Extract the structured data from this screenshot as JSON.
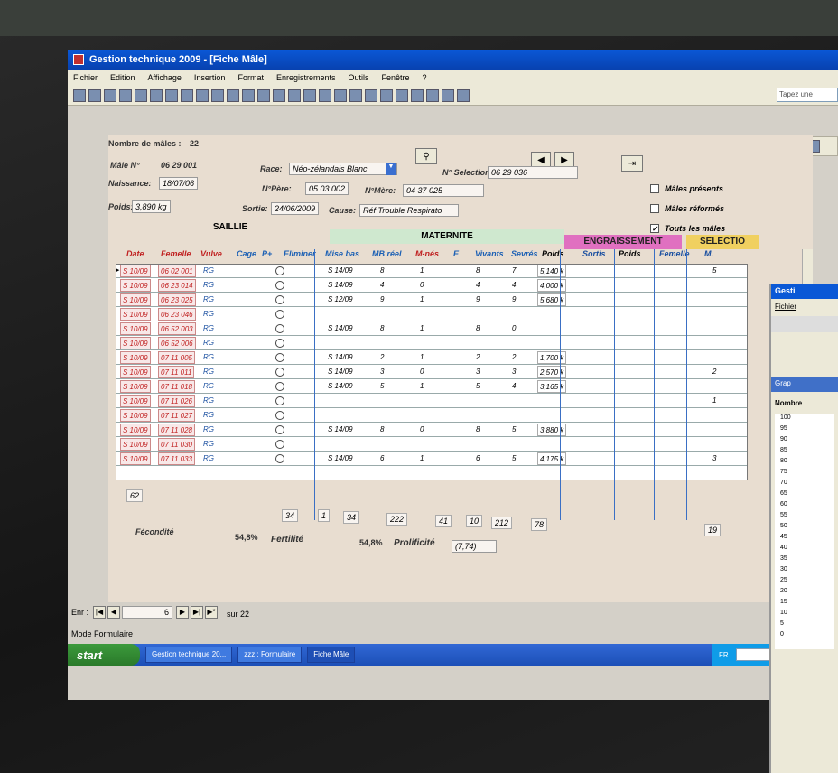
{
  "window": {
    "title": "Gestion technique 2009 - [Fiche Mâle]"
  },
  "menu": [
    "Fichier",
    "Edition",
    "Affichage",
    "Insertion",
    "Format",
    "Enregistrements",
    "Outils",
    "Fenêtre",
    "?"
  ],
  "ask_placeholder": "Tapez une",
  "header": {
    "count_label": "Nombre de mâles :",
    "count_value": "22",
    "male_label": "Mâle N°",
    "male_value": "06 29 001",
    "naissance_label": "Naissance:",
    "naissance_value": "18/07/06",
    "race_label": "Race:",
    "race_value": "Néo-zélandais Blanc",
    "selection_label": "N° Selection",
    "selection_value": "06 29 036",
    "pere_label": "N°Père:",
    "pere_value": "05 03 002",
    "mere_label": "N°Mère:",
    "mere_value": "04 37 025",
    "poids_label": "Poids:",
    "poids_value": "3,890 kg",
    "sortie_label": "Sortie:",
    "sortie_value": "24/06/2009",
    "cause_label": "Cause:",
    "cause_value": "Réf Trouble Respirato"
  },
  "checks": [
    {
      "label": "Mâles présents",
      "checked": false
    },
    {
      "label": "Mâles réformés",
      "checked": false
    },
    {
      "label": "Touts les mâles",
      "checked": true
    }
  ],
  "sections": {
    "saillie": "SAILLIE",
    "maternite": "MATERNITE",
    "engraissement": "ENGRAISSEMENT",
    "selection": "SELECTIO"
  },
  "columns": [
    "Date",
    "Femelle",
    "Vulve",
    "Cage",
    "P+",
    "Eliminer",
    "Mise bas",
    "MB réel",
    "M-nés",
    "E",
    "Vivants",
    "Sevrés",
    "Poids",
    "Sortis",
    "Poids",
    "Femelle",
    "M."
  ],
  "rows": [
    {
      "date": "S 10/09",
      "femelle": "06 02 001",
      "vulve": "RG",
      "mb": "S 14/09",
      "mbr": "8",
      "mnes": "1",
      "viv": "8",
      "sev": "7",
      "poids": "5,140 k",
      "sel": "5"
    },
    {
      "date": "S 10/09",
      "femelle": "06 23 014",
      "vulve": "RG",
      "mb": "S 14/09",
      "mbr": "4",
      "mnes": "0",
      "viv": "4",
      "sev": "4",
      "poids": "4,000 k",
      "sel": ""
    },
    {
      "date": "S 10/09",
      "femelle": "06 23 025",
      "vulve": "RG",
      "mb": "S 12/09",
      "mbr": "9",
      "mnes": "1",
      "viv": "9",
      "sev": "9",
      "poids": "5,680 k",
      "sel": ""
    },
    {
      "date": "S 10/09",
      "femelle": "06 23 046",
      "vulve": "RG",
      "mb": "",
      "mbr": "",
      "mnes": "",
      "viv": "",
      "sev": "",
      "poids": "",
      "sel": ""
    },
    {
      "date": "S 10/09",
      "femelle": "06 52 003",
      "vulve": "RG",
      "mb": "S 14/09",
      "mbr": "8",
      "mnes": "1",
      "viv": "8",
      "sev": "0",
      "poids": "",
      "sel": ""
    },
    {
      "date": "S 10/09",
      "femelle": "06 52 006",
      "vulve": "RG",
      "mb": "",
      "mbr": "",
      "mnes": "",
      "viv": "",
      "sev": "",
      "poids": "",
      "sel": ""
    },
    {
      "date": "S 10/09",
      "femelle": "07 11 005",
      "vulve": "RG",
      "mb": "S 14/09",
      "mbr": "2",
      "mnes": "1",
      "viv": "2",
      "sev": "2",
      "poids": "1,700 k",
      "sel": ""
    },
    {
      "date": "S 10/09",
      "femelle": "07 11 011",
      "vulve": "RG",
      "mb": "S 14/09",
      "mbr": "3",
      "mnes": "0",
      "viv": "3",
      "sev": "3",
      "poids": "2,570 k",
      "sel": "2"
    },
    {
      "date": "S 10/09",
      "femelle": "07 11 018",
      "vulve": "RG",
      "mb": "S 14/09",
      "mbr": "5",
      "mnes": "1",
      "viv": "5",
      "sev": "4",
      "poids": "3,165 k",
      "sel": ""
    },
    {
      "date": "S 10/09",
      "femelle": "07 11 026",
      "vulve": "RG",
      "mb": "",
      "mbr": "",
      "mnes": "",
      "viv": "",
      "sev": "",
      "poids": "",
      "sel": "1"
    },
    {
      "date": "S 10/09",
      "femelle": "07 11 027",
      "vulve": "RG",
      "mb": "",
      "mbr": "",
      "mnes": "",
      "viv": "",
      "sev": "",
      "poids": "",
      "sel": ""
    },
    {
      "date": "S 10/09",
      "femelle": "07 11 028",
      "vulve": "RG",
      "mb": "S 14/09",
      "mbr": "8",
      "mnes": "0",
      "viv": "8",
      "sev": "5",
      "poids": "3,880 k",
      "sel": ""
    },
    {
      "date": "S 10/09",
      "femelle": "07 11 030",
      "vulve": "RG",
      "mb": "",
      "mbr": "",
      "mnes": "",
      "viv": "",
      "sev": "",
      "poids": "",
      "sel": ""
    },
    {
      "date": "S 10/09",
      "femelle": "07 11 033",
      "vulve": "RG",
      "mb": "S 14/09",
      "mbr": "6",
      "mnes": "1",
      "viv": "6",
      "sev": "5",
      "poids": "4,175 k",
      "sel": "3"
    }
  ],
  "totals": {
    "count": "62",
    "cage": "34",
    "elim": "1",
    "mb": "34",
    "mbr": "222",
    "mnes": "41",
    "e": "10",
    "viv": "212",
    "sev": "78",
    "sel": "19"
  },
  "stats": {
    "fecondite_label": "Fécondité",
    "fecondite": "54,8%",
    "fertilite_label": "Fertilité",
    "fertilite": "54,8%",
    "prolificite_label": "Prolificité",
    "prolificite": "(7,74)"
  },
  "nav": {
    "enr_label": "Enr :",
    "current": "6",
    "of": "sur 22",
    "mode": "Mode Formulaire"
  },
  "taskbar": {
    "start": "start",
    "tasks": [
      "Gestion technique 20...",
      "zzz : Formulaire",
      "Fiche Mâle"
    ],
    "tray": "FR"
  },
  "win2": {
    "title": "Gesti",
    "menu": "Fichier",
    "graph_title": "Grap",
    "nombre": "Nombre",
    "axis": [
      "100",
      "95",
      "90",
      "85",
      "80",
      "75",
      "70",
      "65",
      "60",
      "55",
      "50",
      "45",
      "40",
      "35",
      "30",
      "25",
      "20",
      "15",
      "10",
      "5",
      "0"
    ]
  }
}
